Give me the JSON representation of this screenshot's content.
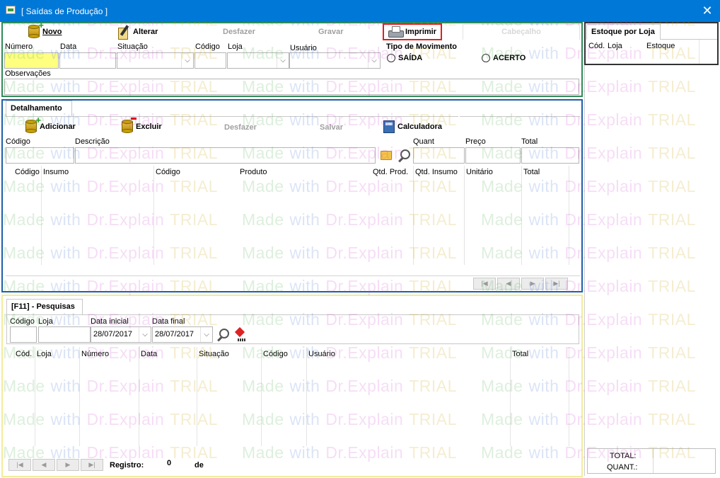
{
  "window": {
    "title": "[ Saídas de Produção ]",
    "close_glyph": "✕"
  },
  "toolbar": {
    "novo": "Novo",
    "alterar": "Alterar",
    "desfazer": "Desfazer",
    "gravar": "Gravar",
    "imprimir": "Imprimir",
    "cabecalho_tab": "Cabeçalho"
  },
  "header_form": {
    "numero_label": "Número",
    "numero_value": "",
    "data_label": "Data",
    "data_value": "",
    "situacao_label": "Situação",
    "situacao_value": "",
    "codigo_label": "Código",
    "codigo_value": "",
    "loja_label": "Loja",
    "loja_value": "",
    "usuario_label": "Usuário",
    "usuario_value": "",
    "tipo_movimento_label": "Tipo de Movimento",
    "radio_saida": "SAÍDA",
    "radio_acerto": "ACERTO",
    "observacoes_label": "Observações",
    "observacoes_value": ""
  },
  "detail": {
    "tab_label": "Detalhamento",
    "adicionar": "Adicionar",
    "excluir": "Excluir",
    "desfazer": "Desfazer",
    "salvar": "Salvar",
    "calculadora": "Calculadora",
    "codigo_label": "Código",
    "descricao_label": "Descrição",
    "quant_label": "Quant",
    "preco_label": "Preço",
    "total_label": "Total",
    "columns": [
      "Código",
      "Insumo",
      "Código",
      "Produto",
      "Qtd. Prod.",
      "Qtd. Insumo",
      "Unitário",
      "Total"
    ]
  },
  "search": {
    "tab_label": "[F11] - Pesquisas",
    "codigo_label": "Código",
    "loja_label": "Loja",
    "data_inicial_label": "Data inicial",
    "data_inicial_value": "28/07/2017",
    "data_final_label": "Data final",
    "data_final_value": "28/07/2017",
    "columns": [
      "Cód.",
      "Loja",
      "Número",
      "Data",
      "Situação",
      "Código",
      "Usuário",
      "Total"
    ],
    "registro_label": "Registro:",
    "registro_value": "0",
    "de_label": "de"
  },
  "stock": {
    "tab_label": "Estoque por Loja",
    "columns": [
      "Cód.",
      "Loja",
      "Estoque"
    ],
    "total_label": "TOTAL:",
    "quant_label": "QUANT.:"
  },
  "navigation": {
    "first": "|◀",
    "prev": "◀",
    "next": "▶",
    "last": "▶|"
  },
  "watermark": {
    "parts": [
      "Made",
      "with",
      "Dr.Explain",
      "TRIAL"
    ]
  },
  "colors": {
    "titlebar": "#0078d7",
    "header_border": "#2e8b57",
    "detail_border": "#1f5fa8",
    "search_border": "#f2ec9a",
    "highlight": "#e02020",
    "input_focus": "#ffff80"
  }
}
